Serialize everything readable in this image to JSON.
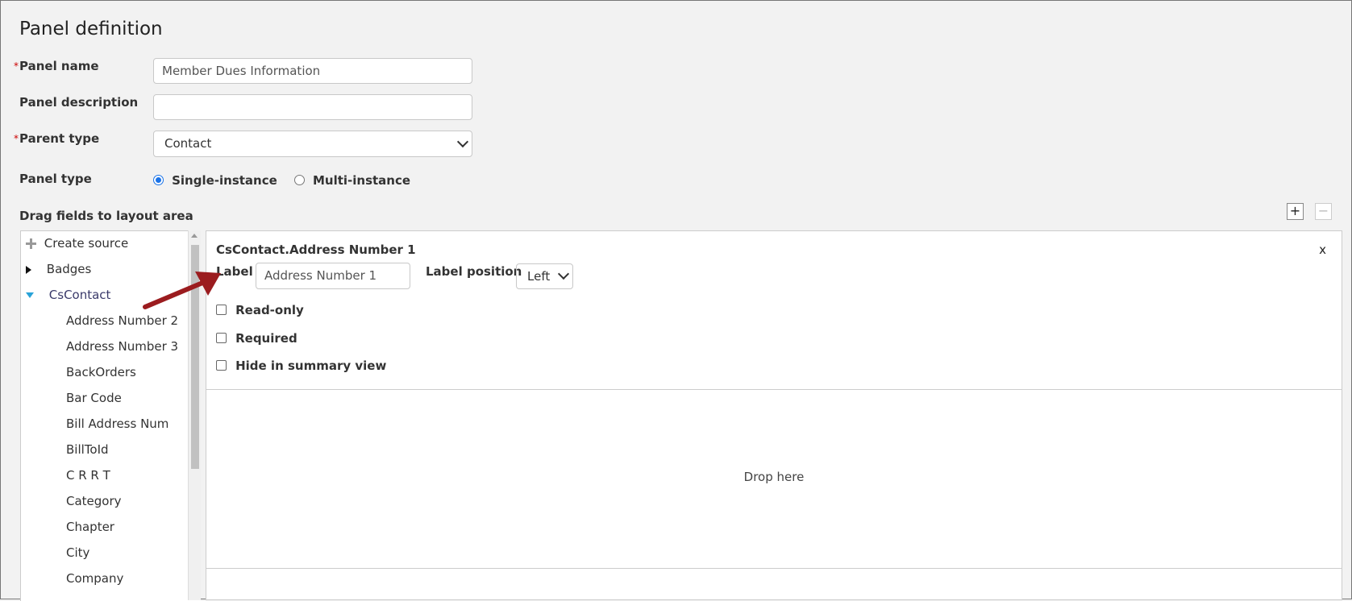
{
  "page_title": "Panel definition",
  "required_marker": "*",
  "form": {
    "panel_name_label": "Panel name",
    "panel_name_value": "Member Dues Information",
    "panel_description_label": "Panel description",
    "panel_description_value": "",
    "parent_type_label": "Parent type",
    "parent_type_value": "Contact",
    "panel_type_label": "Panel type",
    "panel_type_options": [
      "Single-instance",
      "Multi-instance"
    ],
    "panel_type_selected": "Single-instance"
  },
  "drag_label": "Drag fields to layout area",
  "toolbar": {
    "add_label": "+",
    "remove_label": "−"
  },
  "tree": {
    "create_source": "Create source",
    "nodes": [
      {
        "label": "Badges",
        "expanded": false
      },
      {
        "label": "CsContact",
        "expanded": true
      }
    ],
    "children": [
      "Address Number 2",
      "Address Number 3",
      "BackOrders",
      "Bar Code",
      "Bill Address Num",
      "BillToId",
      "C R R T",
      "Category",
      "Chapter",
      "City",
      "Company"
    ]
  },
  "field_editor": {
    "title": "CsContact.Address Number 1",
    "close_label": "x",
    "label_caption": "Label",
    "label_value": "Address Number 1",
    "label_position_caption": "Label position",
    "label_position_value": "Left",
    "checkboxes": [
      "Read-only",
      "Required",
      "Hide in summary view"
    ]
  },
  "drop_here": "Drop here",
  "colors": {
    "accent": "#1a73e8",
    "arrow": "#9b1c1f",
    "required": "#cc0000"
  }
}
